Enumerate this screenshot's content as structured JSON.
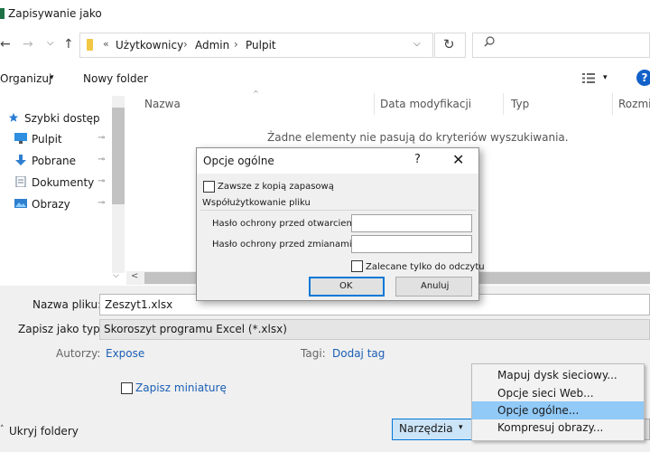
{
  "window": {
    "title": "Zapisywanie jako"
  },
  "nav": {
    "back": "←",
    "forward": "→",
    "recent": "⌵",
    "up": "↑",
    "breadcrumb_chevron": "«",
    "breadcrumbs": [
      "Użytkownicy",
      "Admin",
      "Pulpit"
    ],
    "separator": "›",
    "dropdown": "⌵",
    "refresh": "↻"
  },
  "toolbar": {
    "organize": "Organizuj",
    "organize_caret": "▾",
    "new_folder": "Nowy folder",
    "views_caret": "▾",
    "help": "?"
  },
  "sidebar": {
    "items": [
      {
        "label": "Szybki dostęp",
        "icon": "star-icon"
      },
      {
        "label": "Pulpit",
        "icon": "desktop-icon",
        "pin": "📌"
      },
      {
        "label": "Pobrane",
        "icon": "download-icon",
        "pin": "📌"
      },
      {
        "label": "Dokumenty",
        "icon": "document-icon",
        "pin": "📌"
      },
      {
        "label": "Obrazy",
        "icon": "pictures-icon",
        "pin": "📌"
      }
    ],
    "scroll_down": "⌵"
  },
  "file_list": {
    "columns": [
      "Nazwa",
      "Data modyfikacji",
      "Typ",
      "Rozmiar"
    ],
    "sort_indicator": "^",
    "empty_message": "Żadne elementy nie pasują do kryteriów wyszukiwania.",
    "scroll_left": "<"
  },
  "form": {
    "filename_label": "Nazwa pliku:",
    "filename_value": "Zeszyt1.xlsx",
    "filetype_label": "Zapisz jako typ:",
    "filetype_value": "Skoroszyt programu Excel (*.xlsx)",
    "authors_label": "Autorzy:",
    "authors_value": "Expose",
    "tags_label": "Tagi:",
    "tags_value": "Dodaj tag",
    "thumbnail_label": "Zapisz miniaturę",
    "hide_folders": "Ukryj foldery",
    "tools": "Narzędzia",
    "tools_caret": "▾"
  },
  "tools_menu": {
    "items": [
      "Mapuj dysk sieciowy...",
      "Opcje sieci Web...",
      "Opcje ogólne...",
      "Kompresuj obrazy..."
    ],
    "highlighted_index": 2
  },
  "dialog": {
    "title": "Opcje ogólne",
    "help": "?",
    "close": "✕",
    "backup_label": "Zawsze z kopią zapasową",
    "sharing_heading": "Współużytkowanie pliku",
    "open_password_label": "Hasło ochrony przed otwarciem:",
    "modify_password_label": "Hasło ochrony przed zmianami:",
    "readonly_label": "Zalecane tylko do odczytu",
    "ok": "OK",
    "cancel": "Anuluj"
  },
  "colors": {
    "accent": "#0078d7",
    "link": "#1a5fb4",
    "menu_highlight": "#91c9f7",
    "excel_green": "#1e7145"
  }
}
